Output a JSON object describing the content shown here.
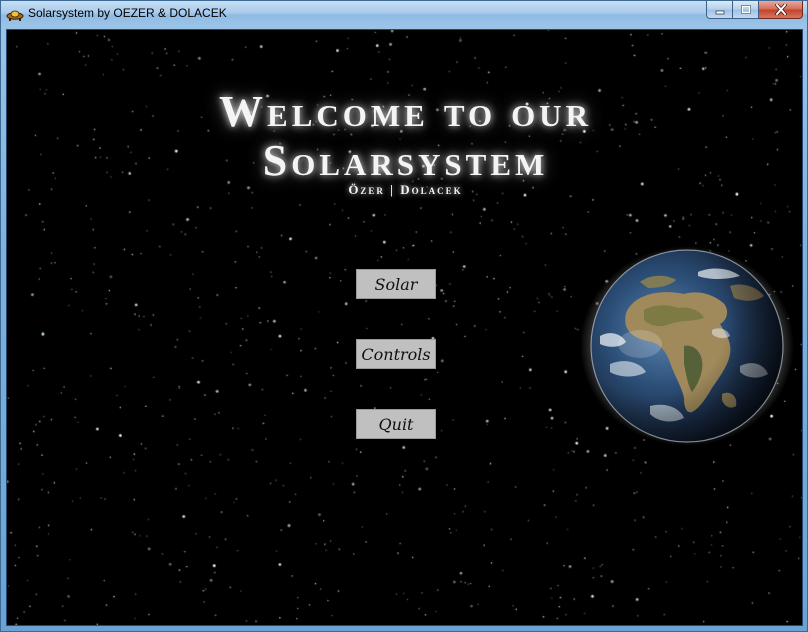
{
  "window": {
    "title": "Solarsystem by OEZER & DOLACEK",
    "icon": "spaceship-icon",
    "caption_buttons": [
      "minimize",
      "maximize",
      "close"
    ]
  },
  "splash": {
    "heading_line1": "Welcome to our",
    "heading_line2": "Solarsystem",
    "subtitle": "Özer | Dolacek",
    "planet": "earth"
  },
  "menu": {
    "solar_label": "Solar",
    "controls_label": "Controls",
    "quit_label": "Quit"
  },
  "colors": {
    "background": "#000000",
    "button_face": "#c0c0c0",
    "heading_text": "#f4f4f4"
  }
}
